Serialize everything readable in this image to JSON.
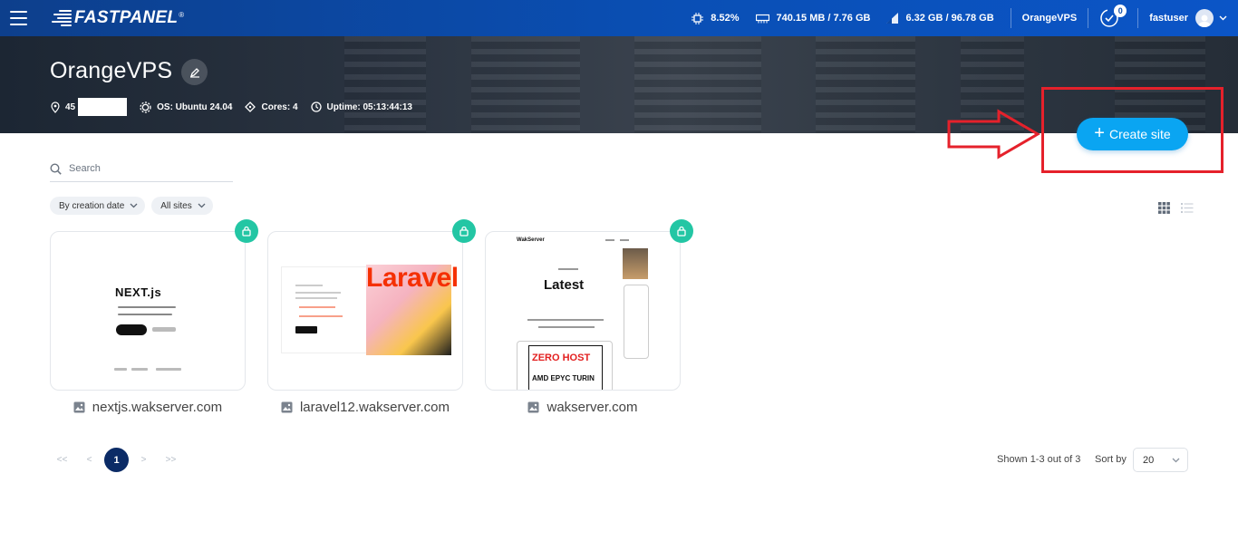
{
  "app": {
    "brand": "FASTPANEL",
    "brand_mark": "®"
  },
  "topbar": {
    "cpu": "8.52%",
    "ram": "740.15 MB / 7.76 GB",
    "disk": "6.32 GB / 96.78 GB",
    "server": "OrangeVPS",
    "notifications": "0",
    "user": "fastuser"
  },
  "server": {
    "name": "OrangeVPS",
    "ip_prefix": "45",
    "os": "OS: Ubuntu 24.04",
    "cores": "Cores: 4",
    "uptime": "Uptime: 05:13:44:13"
  },
  "actions": {
    "create_site": "Create site"
  },
  "search": {
    "placeholder": "Search"
  },
  "filters": {
    "sort": "By creation date",
    "scope": "All sites"
  },
  "sites": [
    {
      "name": "nextjs.wakserver.com",
      "preview_logo": "NEXT.js"
    },
    {
      "name": "laravel12.wakserver.com",
      "preview_logo": "Laravel"
    },
    {
      "name": "wakserver.com",
      "preview_logo": "WakServer",
      "preview_heading": "Latest",
      "preview_banner": "ZERO HOST",
      "preview_banner_sub": "AMD EPYC TURIN"
    }
  ],
  "pagination": {
    "first": "<<",
    "prev": "<",
    "current": "1",
    "next": ">",
    "last": ">>",
    "shown": "Shown 1-3 out of 3",
    "sort_by_label": "Sort by",
    "per_page": "20"
  },
  "colors": {
    "topbar": "#0b4aa8",
    "create_button": "#0aa5f2",
    "annotation": "#e5212b",
    "lock_badge": "#23c6a4",
    "active_page": "#0b2b66"
  }
}
